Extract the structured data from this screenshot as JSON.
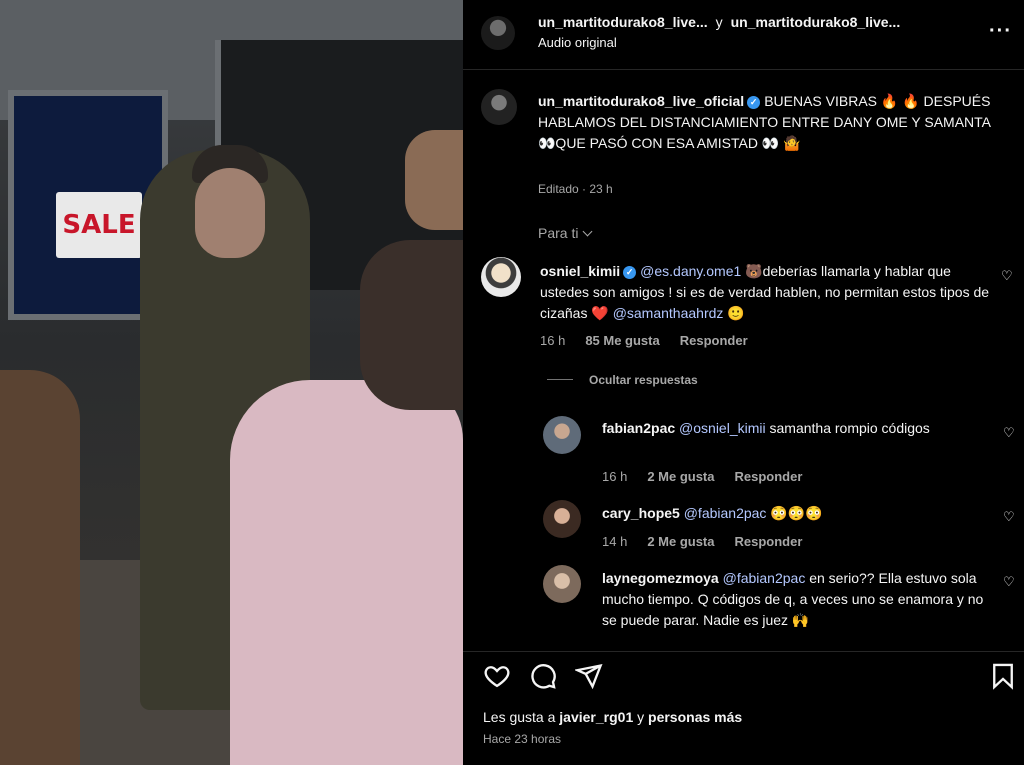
{
  "media": {
    "sign_text": "SALE"
  },
  "header": {
    "user1": "un_martitodurako8_live...",
    "joiner": "y",
    "user2": "un_martitodurako8_live...",
    "subtitle": "Audio original",
    "more_icon": "more-horizontal-icon"
  },
  "caption": {
    "username": "un_martitodurako8_live_oficial",
    "text": "BUENAS VIBRAS 🔥 🔥 DESPUÉS HABLAMOS DEL DISTANCIAMIENTO ENTRE DANY OME Y SAMANTA 👀QUE PASÓ CON ESA AMISTAD 👀 🤷",
    "meta": "Editado · 23 h"
  },
  "para_ti": "Para ti",
  "comments": [
    {
      "username": "osniel_kimii",
      "verified": true,
      "mention1": "@es.dany.ome1",
      "text1": " 🐻deberías llamarla y hablar que ustedes son amigos ! si es de verdad hablen, no permitan estos tipos de cizañas ❤️ ",
      "mention2": "@samanthaahrdz",
      "text2": " 🙂",
      "time": "16 h",
      "likes": "85 Me gusta",
      "reply": "Responder"
    }
  ],
  "hide_replies": "Ocultar respuestas",
  "replies": [
    {
      "username": "fabian2pac",
      "mention": "@osniel_kimii",
      "text": " samantha rompio códigos",
      "time": "16 h",
      "likes": "2 Me gusta",
      "reply": "Responder"
    },
    {
      "username": "cary_hope5",
      "mention": "@fabian2pac",
      "text": " 😳😳😳",
      "time": "14 h",
      "likes": "2 Me gusta",
      "reply": "Responder"
    },
    {
      "username": "laynegomezmoya",
      "mention": "@fabian2pac",
      "text": " en serio?? Ella estuvo sola mucho tiempo. Q códigos de q, a veces uno se enamora y no se puede parar. Nadie es juez 🙌"
    }
  ],
  "footer": {
    "likes_prefix": "Les gusta a ",
    "liker": "javier_rg01",
    "likes_mid": " y ",
    "likes_suffix": "personas más",
    "ago": "Hace 23 horas"
  },
  "icons": [
    "heart-icon",
    "comment-icon",
    "share-icon",
    "bookmark-icon",
    "verified-icon",
    "chevron-down-icon"
  ],
  "colors": {
    "background": "#000000",
    "text": "#f5f5f5",
    "muted": "#a8a8a8",
    "mention": "#b4c8ff",
    "verified": "#3897f0"
  }
}
